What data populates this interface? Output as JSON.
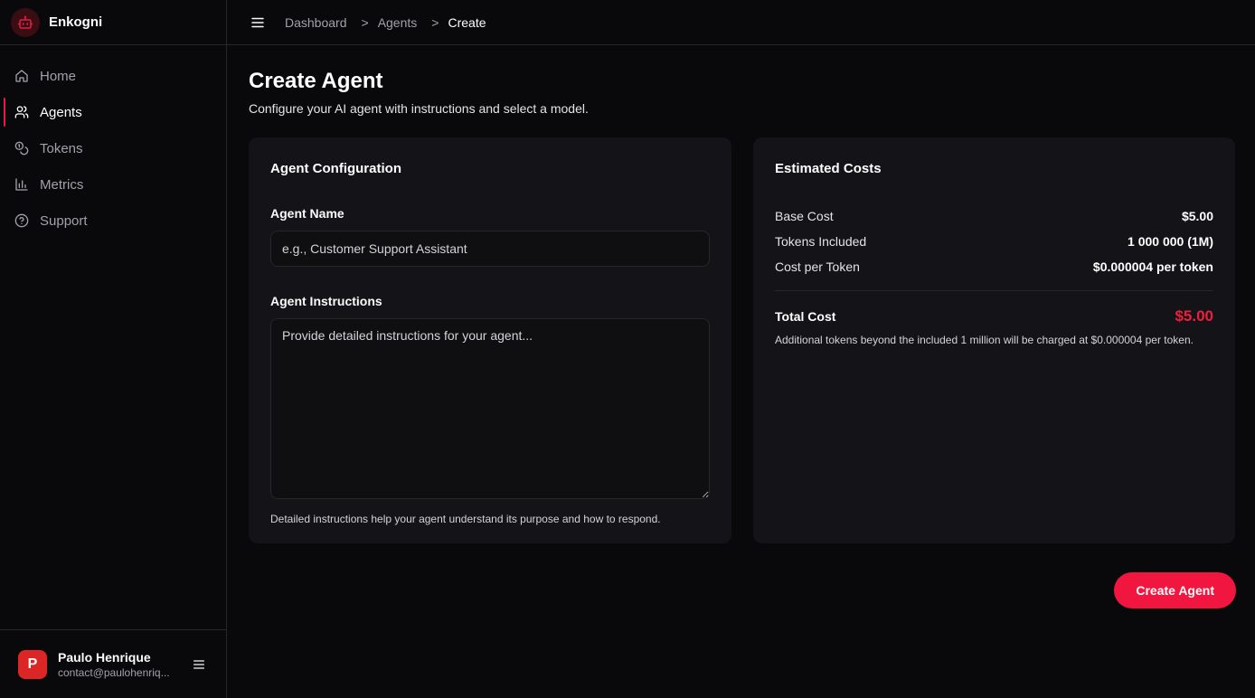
{
  "brand": {
    "name": "Enkogni",
    "logo_icon": "robot-icon",
    "accent": "#e11d48"
  },
  "sidebar": {
    "items": [
      {
        "label": "Home",
        "icon": "home-icon",
        "active": false
      },
      {
        "label": "Agents",
        "icon": "users-icon",
        "active": true
      },
      {
        "label": "Tokens",
        "icon": "coins-icon",
        "active": false
      },
      {
        "label": "Metrics",
        "icon": "bar-chart-icon",
        "active": false
      },
      {
        "label": "Support",
        "icon": "help-circle-icon",
        "active": false
      }
    ]
  },
  "user": {
    "initial": "P",
    "name": "Paulo Henrique",
    "email": "contact@paulohenriq...",
    "avatar_color": "#dc2626"
  },
  "breadcrumb": {
    "items": [
      "Dashboard",
      "Agents",
      "Create"
    ],
    "separator": ">"
  },
  "page": {
    "title": "Create Agent",
    "subtitle": "Configure your AI agent with instructions and select a model."
  },
  "config": {
    "title": "Agent Configuration",
    "name_label": "Agent Name",
    "name_value": "",
    "name_placeholder": "e.g., Customer Support Assistant",
    "instructions_label": "Agent Instructions",
    "instructions_value": "",
    "instructions_placeholder": "Provide detailed instructions for your agent...",
    "instructions_help": "Detailed instructions help your agent understand its purpose and how to respond."
  },
  "costs": {
    "title": "Estimated Costs",
    "rows": [
      {
        "label": "Base Cost",
        "value": "$5.00"
      },
      {
        "label": "Tokens Included",
        "value": "1 000 000 (1M)"
      },
      {
        "label": "Cost per Token",
        "value": "$0.000004 per token"
      }
    ],
    "total_label": "Total Cost",
    "total_value": "$5.00",
    "total_color": "#ef1f3c",
    "note": "Additional tokens beyond the included 1 million will be charged at $0.000004 per token."
  },
  "actions": {
    "create_label": "Create Agent",
    "create_color": "#f0163f"
  }
}
